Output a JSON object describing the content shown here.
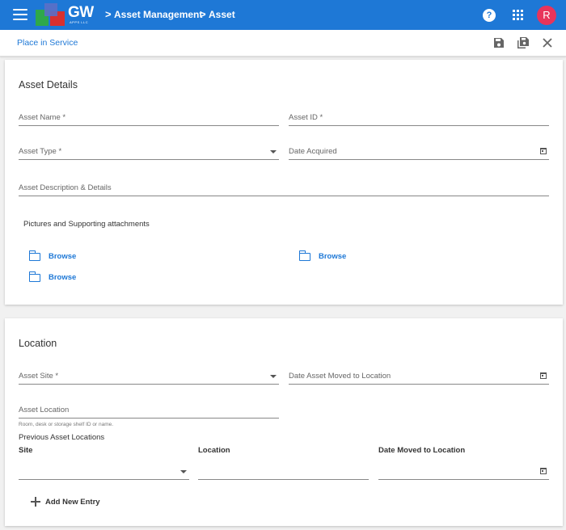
{
  "header": {
    "logo_text": "GW",
    "logo_sub": "APPS LLC",
    "breadcrumb": [
      "Asset Management",
      "Asset"
    ],
    "avatar_initial": "R",
    "accent_color": "#1e78d6",
    "avatar_color": "#e8345b"
  },
  "toolbar": {
    "page_label": "Place in Service",
    "actions": [
      "save-icon",
      "save-all-icon",
      "close-icon"
    ]
  },
  "asset_details": {
    "title": "Asset Details",
    "fields": {
      "asset_name": "Asset Name *",
      "asset_id": "Asset ID *",
      "asset_type": "Asset Type *",
      "date_acquired": "Date Acquired",
      "description": "Asset Description & Details"
    },
    "attachments_label": "Pictures and Supporting attachments",
    "browse_label": "Browse"
  },
  "location": {
    "title": "Location",
    "fields": {
      "asset_site": "Asset Site *",
      "date_moved": "Date Asset Moved to Location",
      "asset_location": "Asset Location",
      "asset_location_helper": "Room, desk or storage shelf ID or name."
    },
    "previous_label": "Previous Asset Locations",
    "columns": [
      "Site",
      "Location",
      "Date Moved to Location"
    ],
    "add_entry_label": "Add New Entry"
  }
}
